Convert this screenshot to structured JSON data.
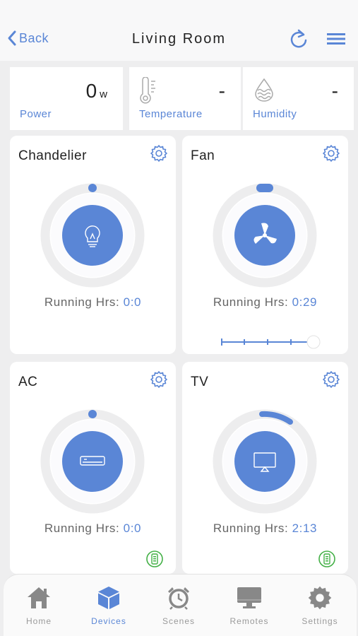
{
  "header": {
    "back_label": "Back",
    "title": "Living Room"
  },
  "stats": [
    {
      "value": "0",
      "unit": "w",
      "label": "Power"
    },
    {
      "value": "-",
      "label": "Temperature"
    },
    {
      "value": "-",
      "label": "Humidity"
    }
  ],
  "devices": [
    {
      "name": "Chandelier",
      "hrs_label": "Running Hrs:",
      "hrs_value": "0:0",
      "level": 0
    },
    {
      "name": "Fan",
      "hrs_label": "Running Hrs:",
      "hrs_value": "0:29",
      "level": 0.02,
      "speed": 1.0
    },
    {
      "name": "AC",
      "hrs_label": "Running Hrs:",
      "hrs_value": "0:0",
      "level": 0
    },
    {
      "name": "TV",
      "hrs_label": "Running Hrs:",
      "hrs_value": "2:13",
      "level": 0.12
    }
  ],
  "tabs": [
    {
      "label": "Home",
      "icon": "home-icon"
    },
    {
      "label": "Devices",
      "icon": "cube-icon",
      "active": true
    },
    {
      "label": "Scenes",
      "icon": "alarm-clock-icon"
    },
    {
      "label": "Remotes",
      "icon": "monitor-icon"
    },
    {
      "label": "Settings",
      "icon": "gear-icon"
    }
  ],
  "colors": {
    "accent": "#5a86d6",
    "tab_inactive": "#9a9a9a",
    "remote_green": "#43b046"
  }
}
